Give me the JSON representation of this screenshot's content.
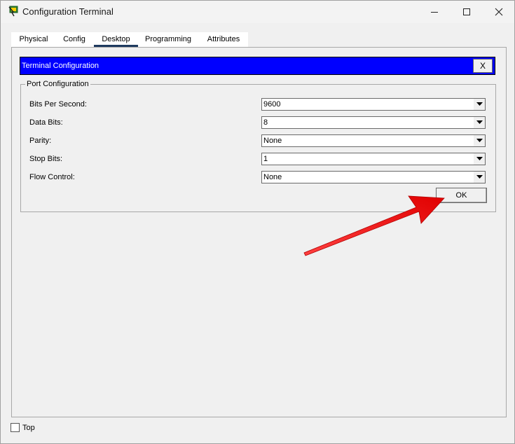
{
  "window": {
    "title": "Configuration Terminal"
  },
  "tabs": [
    {
      "label": "Physical",
      "active": false
    },
    {
      "label": "Config",
      "active": false
    },
    {
      "label": "Desktop",
      "active": true
    },
    {
      "label": "Programming",
      "active": false
    },
    {
      "label": "Attributes",
      "active": false
    }
  ],
  "app": {
    "header_title": "Terminal Configuration",
    "close_label": "X",
    "group_title": "Port Configuration",
    "fields": [
      {
        "label": "Bits Per Second:",
        "value": "9600"
      },
      {
        "label": "Data Bits:",
        "value": "8"
      },
      {
        "label": "Parity:",
        "value": "None"
      },
      {
        "label": "Stop Bits:",
        "value": "1"
      },
      {
        "label": "Flow Control:",
        "value": "None"
      }
    ],
    "ok_label": "OK"
  },
  "footer": {
    "top_label": "Top",
    "top_checked": false
  },
  "colors": {
    "header_bg": "#0000ff",
    "arrow": "#ff1a1a",
    "active_tab_underline": "#1e3a5f"
  }
}
